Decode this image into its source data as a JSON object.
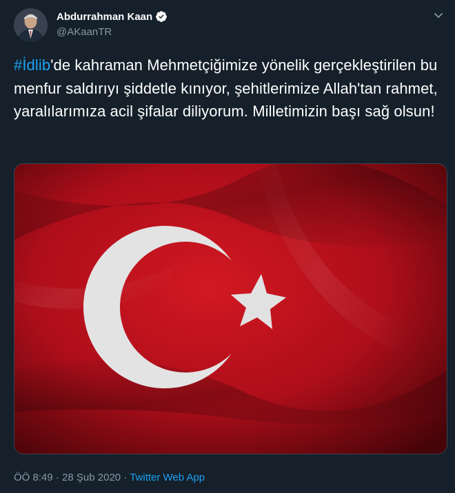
{
  "author": {
    "name": "Abdurrahman Kaan",
    "handle": "@AKaanTR",
    "verified": true
  },
  "tweet": {
    "hashtag": "#İdlib",
    "text": "'de kahraman Mehmetçiğimize yönelik gerçekleştirilen bu menfur saldırıyı şiddetle kınıyor, şehitlerimize Allah'tan rahmet, yaralılarımıza acil şifalar diliyorum. Milletimizin başı sağ olsun!",
    "time": "ÖÖ 8:49",
    "date": "28 Şub 2020",
    "separator": " · ",
    "source": "Twitter Web App"
  },
  "colors": {
    "background": "#15202b",
    "accent": "#1da1f2",
    "secondary_text": "#8899a6",
    "flag_red": "#c8102e"
  },
  "icons": {
    "verified": "verified-badge-icon",
    "menu": "chevron-down-icon"
  }
}
